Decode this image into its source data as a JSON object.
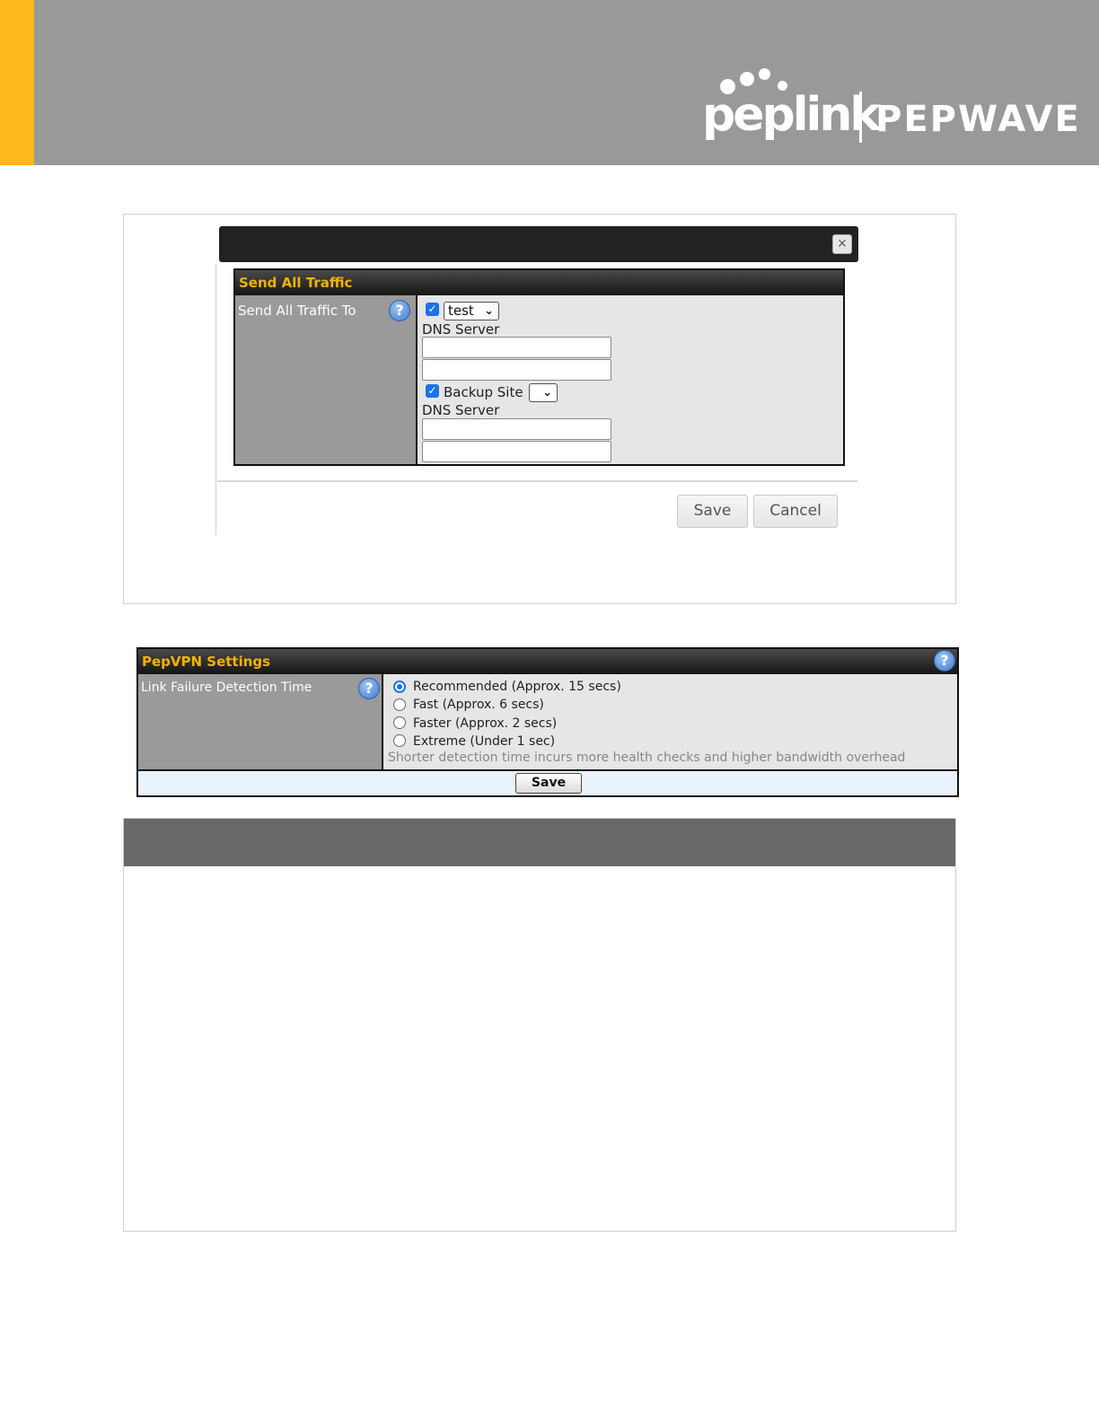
{
  "colors": {
    "accent_bar": "#FFB81C",
    "header_bg": "#999999",
    "section_title": "#F2B300",
    "checkbox": "#1A73E8"
  },
  "branding": {
    "peplink": "peplink",
    "pepwave": "PEPWAVE"
  },
  "send_all_traffic_dialog": {
    "close_icon": "close-icon",
    "section_title": "Send All Traffic",
    "row_label": "Send All Traffic To",
    "primary": {
      "checked": true,
      "selected": "test",
      "dns_label": "DNS Server",
      "dns_values": [
        "",
        ""
      ]
    },
    "backup": {
      "checked": true,
      "label": "Backup Site",
      "selected": "",
      "dns_label": "DNS Server",
      "dns_values": [
        "",
        ""
      ]
    },
    "save_label": "Save",
    "cancel_label": "Cancel"
  },
  "pepvpn_settings": {
    "section_title": "PepVPN Settings",
    "row_label": "Link Failure Detection Time",
    "options": [
      {
        "label": "Recommended (Approx. 15 secs)",
        "selected": true
      },
      {
        "label": "Fast (Approx. 6 secs)",
        "selected": false
      },
      {
        "label": "Faster (Approx. 2 secs)",
        "selected": false
      },
      {
        "label": "Extreme (Under 1 sec)",
        "selected": false
      }
    ],
    "hint": "Shorter detection time incurs more health checks and higher bandwidth overhead",
    "save_label": "Save"
  }
}
